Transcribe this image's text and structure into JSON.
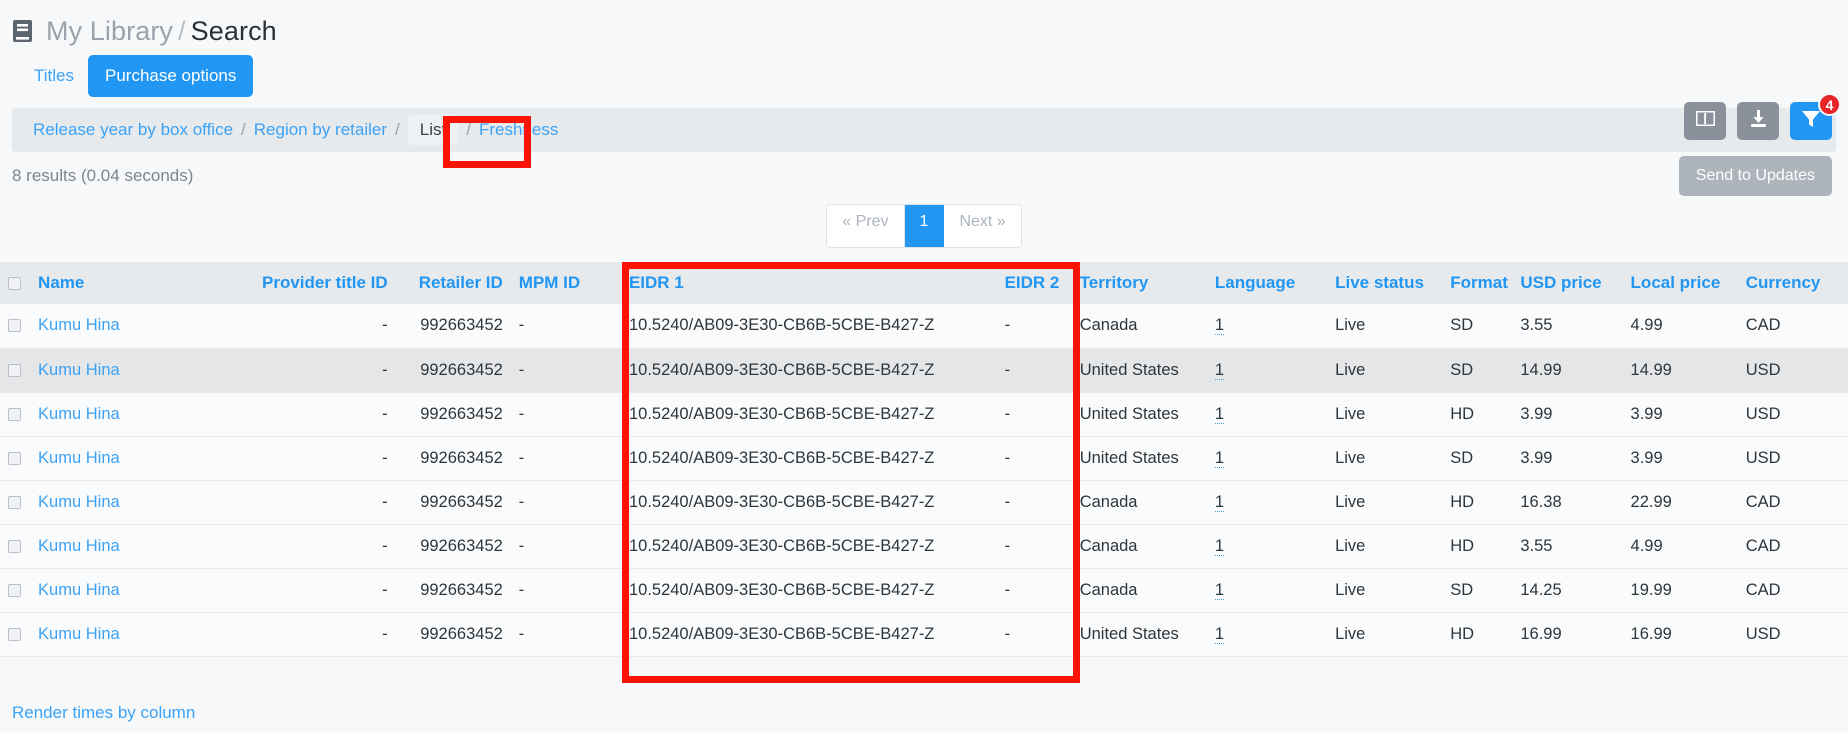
{
  "header": {
    "icon": "book-icon",
    "breadcrumb_root": "My Library",
    "breadcrumb_sep": "/",
    "breadcrumb_current": "Search"
  },
  "tabs": [
    {
      "label": "Titles",
      "active": false
    },
    {
      "label": "Purchase options",
      "active": true
    }
  ],
  "toolbar": {
    "columns_icon": "columns-layout-icon",
    "download_icon": "download-icon",
    "filter_icon": "filter-icon",
    "filter_badge": "4",
    "accent_blue": "#2196f3",
    "badge_red": "#e8262a"
  },
  "breadcrumb_nav": {
    "items": [
      {
        "label": "Release year by box office",
        "current": false
      },
      {
        "label": "Region by retailer",
        "current": false
      },
      {
        "label": "List",
        "current": true
      },
      {
        "label": "Freshness",
        "current": false
      }
    ],
    "separator": "/"
  },
  "results": {
    "text": "8 results (0.04 seconds)",
    "send_button": "Send to Updates"
  },
  "pagination": {
    "prev": "« Prev",
    "page": "1",
    "next": "Next »"
  },
  "table": {
    "columns": [
      "Name",
      "Provider title ID",
      "Retailer ID",
      "MPM ID",
      "EIDR 1",
      "EIDR 2",
      "Territory",
      "Language",
      "Live status",
      "Format",
      "USD price",
      "Local price",
      "Currency"
    ],
    "rows": [
      {
        "name": "Kumu Hina",
        "provider_title_id": "-",
        "retailer_id": "992663452",
        "mpm_id": "-",
        "eidr1": "10.5240/AB09-3E30-CB6B-5CBE-B427-Z",
        "eidr2": "-",
        "territory": "Canada",
        "language": "1",
        "live_status": "Live",
        "format": "SD",
        "usd_price": "3.55",
        "local_price": "4.99",
        "currency": "CAD"
      },
      {
        "name": "Kumu Hina",
        "provider_title_id": "-",
        "retailer_id": "992663452",
        "mpm_id": "-",
        "eidr1": "10.5240/AB09-3E30-CB6B-5CBE-B427-Z",
        "eidr2": "-",
        "territory": "United States",
        "language": "1",
        "live_status": "Live",
        "format": "SD",
        "usd_price": "14.99",
        "local_price": "14.99",
        "currency": "USD"
      },
      {
        "name": "Kumu Hina",
        "provider_title_id": "-",
        "retailer_id": "992663452",
        "mpm_id": "-",
        "eidr1": "10.5240/AB09-3E30-CB6B-5CBE-B427-Z",
        "eidr2": "-",
        "territory": "United States",
        "language": "1",
        "live_status": "Live",
        "format": "HD",
        "usd_price": "3.99",
        "local_price": "3.99",
        "currency": "USD"
      },
      {
        "name": "Kumu Hina",
        "provider_title_id": "-",
        "retailer_id": "992663452",
        "mpm_id": "-",
        "eidr1": "10.5240/AB09-3E30-CB6B-5CBE-B427-Z",
        "eidr2": "-",
        "territory": "United States",
        "language": "1",
        "live_status": "Live",
        "format": "SD",
        "usd_price": "3.99",
        "local_price": "3.99",
        "currency": "USD"
      },
      {
        "name": "Kumu Hina",
        "provider_title_id": "-",
        "retailer_id": "992663452",
        "mpm_id": "-",
        "eidr1": "10.5240/AB09-3E30-CB6B-5CBE-B427-Z",
        "eidr2": "-",
        "territory": "Canada",
        "language": "1",
        "live_status": "Live",
        "format": "HD",
        "usd_price": "16.38",
        "local_price": "22.99",
        "currency": "CAD"
      },
      {
        "name": "Kumu Hina",
        "provider_title_id": "-",
        "retailer_id": "992663452",
        "mpm_id": "-",
        "eidr1": "10.5240/AB09-3E30-CB6B-5CBE-B427-Z",
        "eidr2": "-",
        "territory": "Canada",
        "language": "1",
        "live_status": "Live",
        "format": "HD",
        "usd_price": "3.55",
        "local_price": "4.99",
        "currency": "CAD"
      },
      {
        "name": "Kumu Hina",
        "provider_title_id": "-",
        "retailer_id": "992663452",
        "mpm_id": "-",
        "eidr1": "10.5240/AB09-3E30-CB6B-5CBE-B427-Z",
        "eidr2": "-",
        "territory": "Canada",
        "language": "1",
        "live_status": "Live",
        "format": "SD",
        "usd_price": "14.25",
        "local_price": "19.99",
        "currency": "CAD"
      },
      {
        "name": "Kumu Hina",
        "provider_title_id": "-",
        "retailer_id": "992663452",
        "mpm_id": "-",
        "eidr1": "10.5240/AB09-3E30-CB6B-5CBE-B427-Z",
        "eidr2": "-",
        "territory": "United States",
        "language": "1",
        "live_status": "Live",
        "format": "HD",
        "usd_price": "16.99",
        "local_price": "16.99",
        "currency": "USD"
      }
    ]
  },
  "footer": {
    "link": "Render times by column"
  },
  "annotations": {
    "highlight_color": "#fb1405"
  }
}
